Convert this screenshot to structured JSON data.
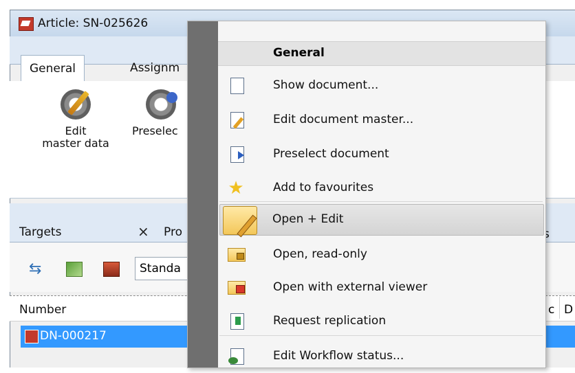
{
  "window": {
    "title": "Article: SN-025626",
    "ribbon_tabs": [
      "General",
      "Assignm"
    ],
    "ribbon_buttons": [
      {
        "label_line1": "Edit",
        "label_line2": "master data",
        "icon": "edit-gear-icon"
      },
      {
        "label_line1": "Preselec",
        "label_line2": "",
        "icon": "preselect-gear-icon"
      }
    ],
    "panel_tabs": [
      "Targets",
      "Pro"
    ],
    "panel_tab_close": "×",
    "right_fragment": "s",
    "toolbar": {
      "combo_value": "Standa"
    },
    "grid": {
      "column_number": "Number",
      "column_c": "c",
      "column_d": "D",
      "selected_row": "DN-000217"
    }
  },
  "context_menu": {
    "header": "General",
    "items": [
      {
        "label": "Show document...",
        "icon": "document-icon"
      },
      {
        "label": "Edit document master...",
        "icon": "document-edit-icon"
      },
      {
        "label": "Preselect document",
        "icon": "document-preselect-icon"
      },
      {
        "label": "Add to favourites",
        "icon": "star-icon"
      },
      {
        "label": "Open + Edit",
        "icon": "folder-open-edit-icon",
        "highlighted": true
      },
      {
        "label": "Open, read-only",
        "icon": "folder-lock-icon"
      },
      {
        "label": "Open with external viewer",
        "icon": "folder-external-icon"
      },
      {
        "label": "Request replication",
        "icon": "replication-icon"
      },
      {
        "label": "Edit Workflow status...",
        "icon": "workflow-icon"
      }
    ]
  },
  "colors": {
    "selection": "#3399ff",
    "menu_gutter": "#6f6f6f",
    "menu_background": "#f5f5f5"
  }
}
